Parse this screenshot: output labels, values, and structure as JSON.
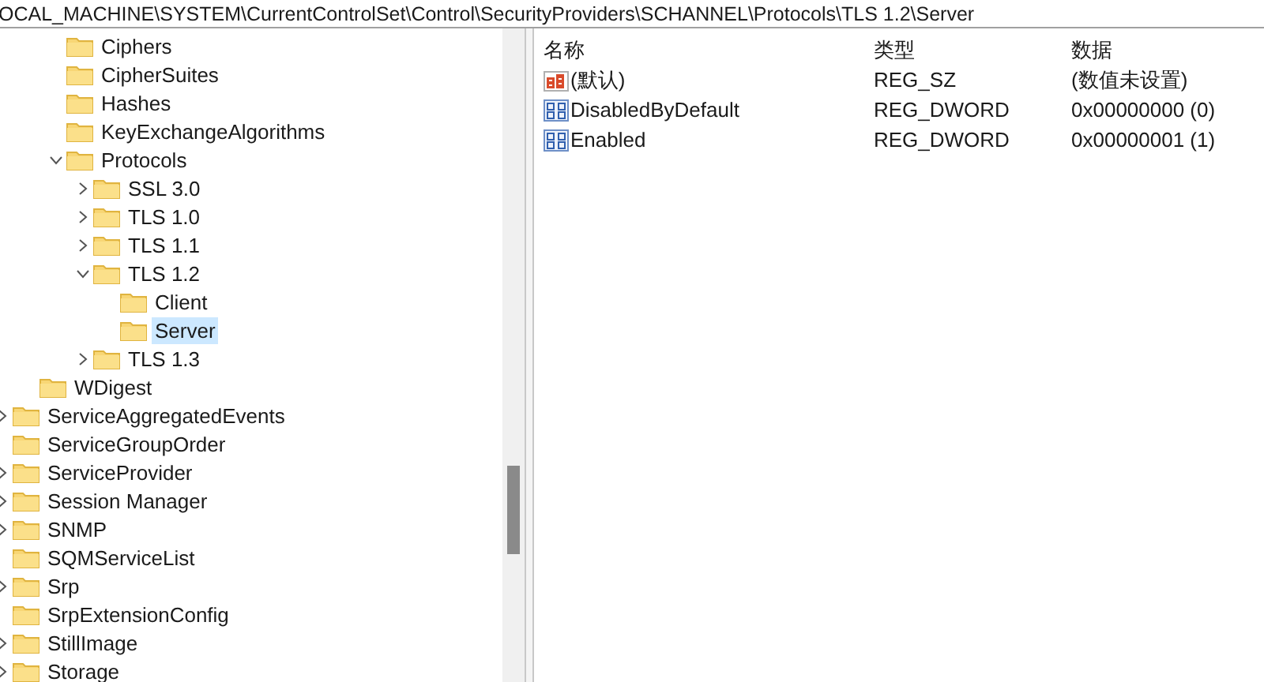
{
  "address_bar": {
    "path": "OCAL_MACHINE\\SYSTEM\\CurrentControlSet\\Control\\SecurityProviders\\SCHANNEL\\Protocols\\TLS 1.2\\Server"
  },
  "tree": [
    {
      "children": [
        {
          "children": [
            {
              "label": "Ciphers",
              "expandable": false,
              "selected": false
            },
            {
              "label": "CipherSuites",
              "expandable": false,
              "selected": false
            },
            {
              "label": "Hashes",
              "expandable": false,
              "selected": false
            },
            {
              "label": "KeyExchangeAlgorithms",
              "expandable": false,
              "selected": false
            },
            {
              "label": "Protocols",
              "expandable": true,
              "expanded": true,
              "selected": false,
              "children": [
                {
                  "label": "SSL 3.0",
                  "expandable": true,
                  "expanded": false,
                  "selected": false
                },
                {
                  "label": "TLS 1.0",
                  "expandable": true,
                  "expanded": false,
                  "selected": false
                },
                {
                  "label": "TLS 1.1",
                  "expandable": true,
                  "expanded": false,
                  "selected": false
                },
                {
                  "label": "TLS 1.2",
                  "expandable": true,
                  "expanded": true,
                  "selected": false,
                  "children": [
                    {
                      "label": "Client",
                      "expandable": false,
                      "selected": false
                    },
                    {
                      "label": "Server",
                      "expandable": false,
                      "selected": true
                    }
                  ]
                },
                {
                  "label": "TLS 1.3",
                  "expandable": true,
                  "expanded": false,
                  "selected": false
                }
              ]
            }
          ]
        },
        {
          "label": "WDigest",
          "expandable": false,
          "selected": false
        }
      ]
    },
    {
      "label": "ServiceAggregatedEvents",
      "expandable": true,
      "expanded": false,
      "selected": false
    },
    {
      "label": "ServiceGroupOrder",
      "expandable": false,
      "selected": false
    },
    {
      "label": "ServiceProvider",
      "expandable": true,
      "expanded": false,
      "selected": false
    },
    {
      "label": "Session Manager",
      "expandable": true,
      "expanded": false,
      "selected": false
    },
    {
      "label": "SNMP",
      "expandable": true,
      "expanded": false,
      "selected": false
    },
    {
      "label": "SQMServiceList",
      "expandable": false,
      "selected": false
    },
    {
      "label": "Srp",
      "expandable": true,
      "expanded": false,
      "selected": false
    },
    {
      "label": "SrpExtensionConfig",
      "expandable": false,
      "selected": false
    },
    {
      "label": "StillImage",
      "expandable": true,
      "expanded": false,
      "selected": false
    },
    {
      "label": "Storage",
      "expandable": true,
      "expanded": false,
      "selected": false
    }
  ],
  "values": {
    "columns": [
      "名称",
      "类型",
      "数据"
    ],
    "rows": [
      {
        "kind": "string",
        "name": "(默认)",
        "type": "REG_SZ",
        "data": "(数值未设置)"
      },
      {
        "kind": "binary",
        "name": "DisabledByDefault",
        "type": "REG_DWORD",
        "data": "0x00000000 (0)"
      },
      {
        "kind": "binary",
        "name": "Enabled",
        "type": "REG_DWORD",
        "data": "0x00000001 (1)"
      }
    ]
  }
}
